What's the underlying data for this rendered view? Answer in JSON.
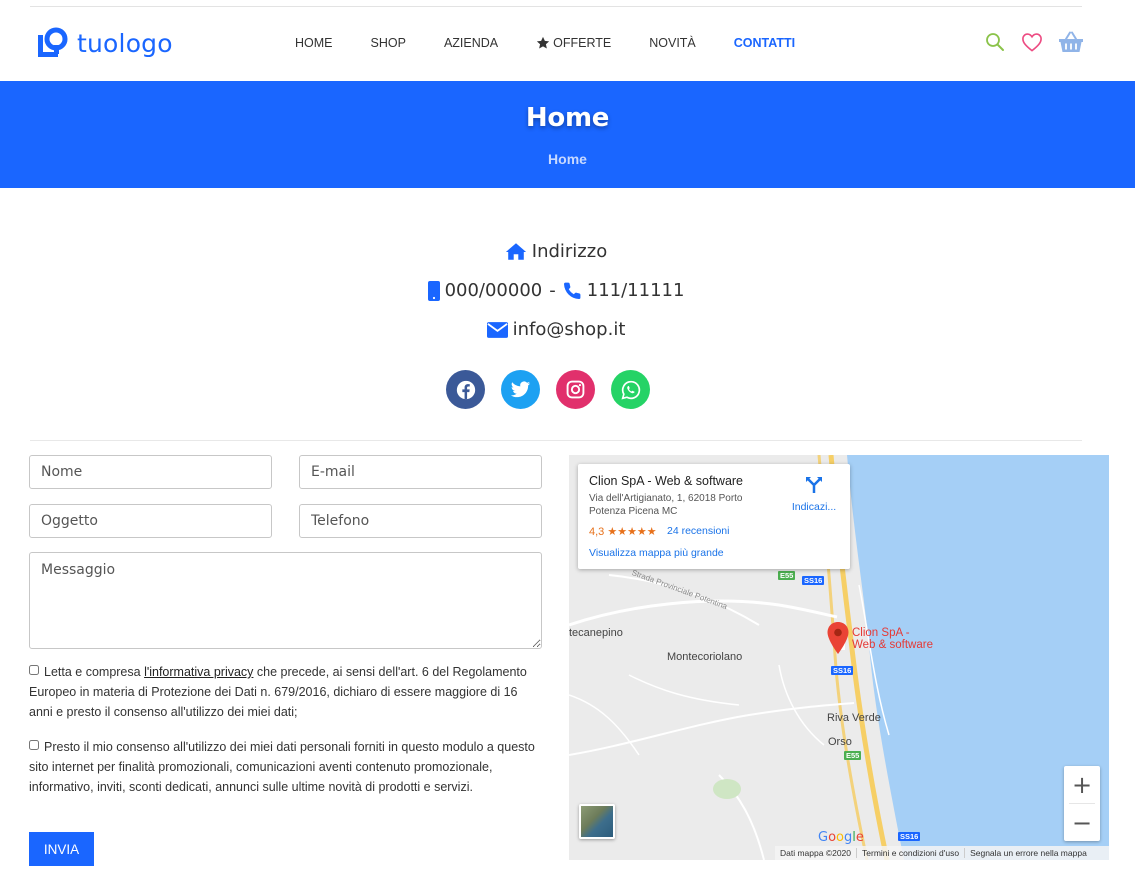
{
  "brand": {
    "name": "tuologo",
    "color": "#1a66ff"
  },
  "nav": {
    "items": [
      {
        "label": "HOME"
      },
      {
        "label": "SHOP"
      },
      {
        "label": "AZIENDA"
      },
      {
        "label": "OFFERTE",
        "icon": "star-icon"
      },
      {
        "label": "NOVITÀ"
      },
      {
        "label": "CONTATTI",
        "active": true
      }
    ]
  },
  "header_icons": [
    "search-icon",
    "heart-icon",
    "basket-icon"
  ],
  "banner": {
    "title": "Home",
    "breadcrumb": "Home"
  },
  "contact": {
    "address": "Indirizzo",
    "mobile": "000/00000",
    "separator": "-",
    "phone": "111/11111",
    "email": "info@shop.it"
  },
  "social": [
    {
      "name": "facebook",
      "color": "#3b5998"
    },
    {
      "name": "twitter",
      "color": "#1da1f2"
    },
    {
      "name": "instagram",
      "color": "#e1306c"
    },
    {
      "name": "whatsapp",
      "color": "#25d366"
    }
  ],
  "form": {
    "name_placeholder": "Nome",
    "email_placeholder": "E-mail",
    "subject_placeholder": "Oggetto",
    "phone_placeholder": "Telefono",
    "message_placeholder": "Messaggio",
    "consent1_pre": "Letta e compresa ",
    "consent1_link": "l'informativa privacy",
    "consent1_post": " che precede, ai sensi dell'art. 6 del Regolamento Europeo in materia di Protezione dei Dati n. 679/2016, dichiaro di essere maggiore di 16 anni e presto il consenso all'utilizzo dei miei dati;",
    "consent2": "Presto il mio consenso all'utilizzo dei miei dati personali forniti in questo modulo a questo sito internet per finalità promozionali, comunicazioni aventi contenuto promozionale, informativo, inviti, sconti dedicati, annunci sulle ultime novità di prodotti e servizi.",
    "submit_label": "INVIA"
  },
  "map": {
    "place_title": "Clion SpA - Web & software",
    "place_address": "Via dell'Artigianato, 1, 62018 Porto Potenza Picena MC",
    "rating": "4,3 ★★★★★",
    "reviews": "24 recensioni",
    "larger_map": "Visualizza mappa più grande",
    "directions": "Indicazi...",
    "pin_label_1": "Clion SpA -",
    "pin_label_2": "Web & software",
    "places": [
      "Montecoriolano",
      "Riva Verde",
      "Orso",
      "tecanepino",
      "Strada Provinciale Potentina"
    ],
    "roads": [
      "E55",
      "SS16",
      "SS16",
      "E55",
      "SS16"
    ],
    "zoom_in": "+",
    "zoom_out": "−",
    "google": "Google",
    "footer": [
      "Dati mappa ©2020",
      "Termini e condizioni d'uso",
      "Segnala un errore nella mappa"
    ]
  }
}
